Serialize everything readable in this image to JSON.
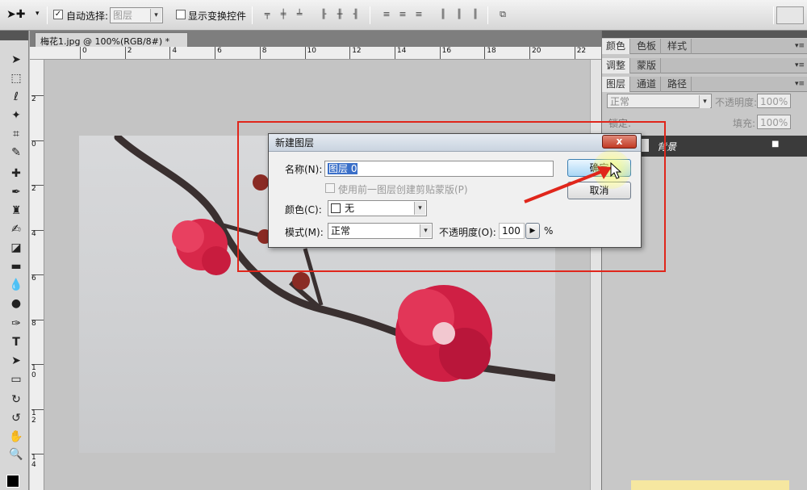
{
  "options_bar": {
    "auto_select_label": "自动选择:",
    "auto_select_value": "图层",
    "show_transform_label": "显示变换控件"
  },
  "document": {
    "tab_title": "梅花1.jpg @ 100%(RGB/8#) *",
    "tab_close": "×",
    "ruler_top": [
      "0",
      "2",
      "4",
      "6",
      "8",
      "10",
      "12",
      "14",
      "16",
      "18",
      "20",
      "22"
    ],
    "ruler_left": [
      "2",
      "0",
      "2",
      "4",
      "6",
      "8",
      "1\n0",
      "1\n2",
      "1\n4"
    ]
  },
  "panels": {
    "row1_tabs": [
      "颜色",
      "色板",
      "样式"
    ],
    "row2_tabs": [
      "调整",
      "蒙版"
    ],
    "row3_tabs": [
      "图层",
      "通道",
      "路径"
    ],
    "blend_mode": "正常",
    "opacity_label": "不透明度:",
    "opacity_value": "100%",
    "lock_label": "锁定:",
    "fill_label": "填充:",
    "fill_value": "100%",
    "layer_name": "背景",
    "menu_glyph": "▾≡"
  },
  "dialog": {
    "title": "新建图层",
    "close": "x",
    "name_label": "名称(N):",
    "name_value": "图层 0",
    "clip_label": "使用前一图层创建剪贴蒙版(P)",
    "color_label": "颜色(C):",
    "color_value": "无",
    "mode_label": "模式(M):",
    "mode_value": "正常",
    "opacity_label": "不透明度(O):",
    "opacity_value": "100",
    "opacity_unit": "%",
    "ok": "确定",
    "cancel": "取消"
  },
  "colors": {
    "accent_red": "#e0261b",
    "ok_blue": "#a9d6f5"
  }
}
